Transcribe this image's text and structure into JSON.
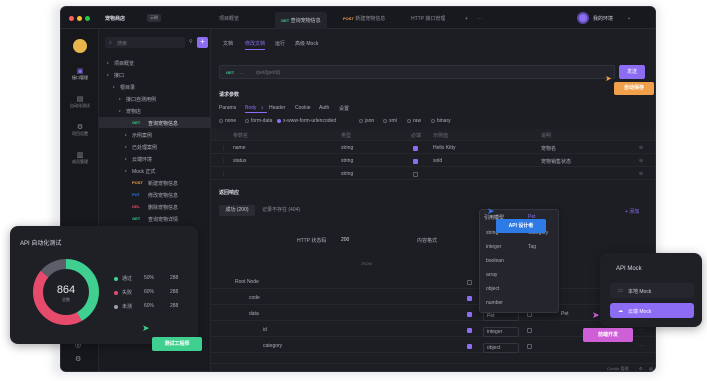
{
  "window": {
    "app_name": "宠物商店",
    "app_badge": "示例",
    "tabs": [
      {
        "method": "",
        "label": "项目概览"
      },
      {
        "method": "GET",
        "label": "查询宠物信息"
      },
      {
        "method": "POST",
        "label": "新建宠物信息"
      },
      {
        "method": "",
        "label": "HTTP 接口管理"
      }
    ],
    "user_label": "我的环境"
  },
  "sidebar": {
    "nav": [
      {
        "icon": "api-icon",
        "label": "接口管理"
      },
      {
        "icon": "automation-icon",
        "label": "自动化测试"
      },
      {
        "icon": "document-icon",
        "label": "项目设置"
      },
      {
        "icon": "members-icon",
        "label": "成员管理"
      }
    ]
  },
  "tree": {
    "search_placeholder": "搜索",
    "items": [
      {
        "indent": 0,
        "method": "",
        "label": "项目概览"
      },
      {
        "indent": 0,
        "method": "",
        "label": "接口"
      },
      {
        "indent": 1,
        "method": "",
        "label": "根目录"
      },
      {
        "indent": 2,
        "method": "",
        "label": "接口自测用例"
      },
      {
        "indent": 2,
        "method": "",
        "label": "宠物店"
      },
      {
        "indent": 3,
        "method": "GET",
        "label": "查询宠物信息"
      },
      {
        "indent": 3,
        "method": "",
        "label": "示例案例"
      },
      {
        "indent": 3,
        "method": "",
        "label": "已处理案例"
      },
      {
        "indent": 3,
        "method": "",
        "label": "云端环境"
      },
      {
        "indent": 3,
        "method": "",
        "label": "Mock 正式"
      },
      {
        "indent": 3,
        "method": "POST",
        "label": "新建宠物信息"
      },
      {
        "indent": 3,
        "method": "PUT",
        "label": "修改宠物信息"
      },
      {
        "indent": 3,
        "method": "DEL",
        "label": "删除宠物信息"
      },
      {
        "indent": 3,
        "method": "GET",
        "label": "查询宠物详情"
      },
      {
        "indent": 1,
        "method": "",
        "label": "数据模型"
      }
    ]
  },
  "main": {
    "tabs": [
      "文档",
      "修改文档",
      "运行",
      "高级 Mock"
    ],
    "request": {
      "method": "GET",
      "url_placeholder": "/pet/{petId}",
      "send_label": "发送",
      "save_label": "保存",
      "extra_label": "调试"
    },
    "params_title": "请求参数",
    "param_tabs": [
      "Params",
      "Body",
      "Header",
      "Cookie",
      "Auth",
      "设置"
    ],
    "body_count": "3",
    "body_types": [
      "none",
      "form-data",
      "x-www-form-urlencoded",
      "json",
      "xml",
      "raw",
      "binary"
    ],
    "columns": [
      "参数名",
      "类型",
      "必填",
      "示例值",
      "说明"
    ],
    "rows": [
      {
        "name": "name",
        "type": "string",
        "example": "Hello Kitty",
        "desc": "宠物名"
      },
      {
        "name": "status",
        "type": "string",
        "example": "sold",
        "desc": "宠物销售状态"
      },
      {
        "name": "",
        "type": "string",
        "example": "",
        "desc": ""
      }
    ],
    "response_title": "返回响应",
    "response_tabs": [
      "成功 (200)",
      "记录不存在 (404)"
    ],
    "add_label": "+ 添加",
    "http_status_label": "HTTP 状态码",
    "http_status_value": "200",
    "content_label": "内容格式",
    "json_label": "JSON",
    "schema_rows": [
      {
        "indent": 0,
        "name": "Root Node",
        "type": "object"
      },
      {
        "indent": 1,
        "name": "code",
        "type": "integer"
      },
      {
        "indent": 1,
        "name": "data",
        "type": "Pet",
        "extra": "Pet"
      },
      {
        "indent": 2,
        "name": "id",
        "type": "integer"
      },
      {
        "indent": 2,
        "name": "category",
        "type": "object"
      }
    ],
    "type_menu": {
      "header": "引用模型",
      "header_right": "Pet",
      "items": [
        "string",
        "integer",
        "boolean",
        "array",
        "object",
        "number"
      ],
      "right_items": [
        "Category",
        "Tag"
      ]
    }
  },
  "callouts": {
    "save": "自动保存",
    "api_design": "API 设计者",
    "run": "测试工程师",
    "mock": "前端开发"
  },
  "test_card": {
    "title": "API 自动化测试",
    "total": "864",
    "total_label": "总数",
    "legend": [
      {
        "label": "通过",
        "percent": "50%",
        "count": "288",
        "color": "#3fd08f"
      },
      {
        "label": "失败",
        "percent": "60%",
        "count": "288",
        "color": "#e64b6c"
      },
      {
        "label": "未测",
        "percent": "60%",
        "count": "288",
        "color": "#9b9dab"
      }
    ],
    "ring": [
      {
        "fraction": 0.42,
        "color": "#3fd08f"
      },
      {
        "fraction": 0.44,
        "color": "#e64b6c"
      },
      {
        "fraction": 0.14,
        "color": "#5c5e6a"
      }
    ]
  },
  "mock_card": {
    "title": "API Mock",
    "options": [
      "本地 Mock",
      "云端 Mock"
    ],
    "selected": 1
  },
  "status_bar": {
    "cookie_label": "Cookie 管理"
  },
  "colors": {
    "accent": "#8c6cf2",
    "orange": "#f0a04b",
    "blue": "#2e7be6",
    "green": "#3fd08f",
    "pink": "#e64b6c"
  }
}
